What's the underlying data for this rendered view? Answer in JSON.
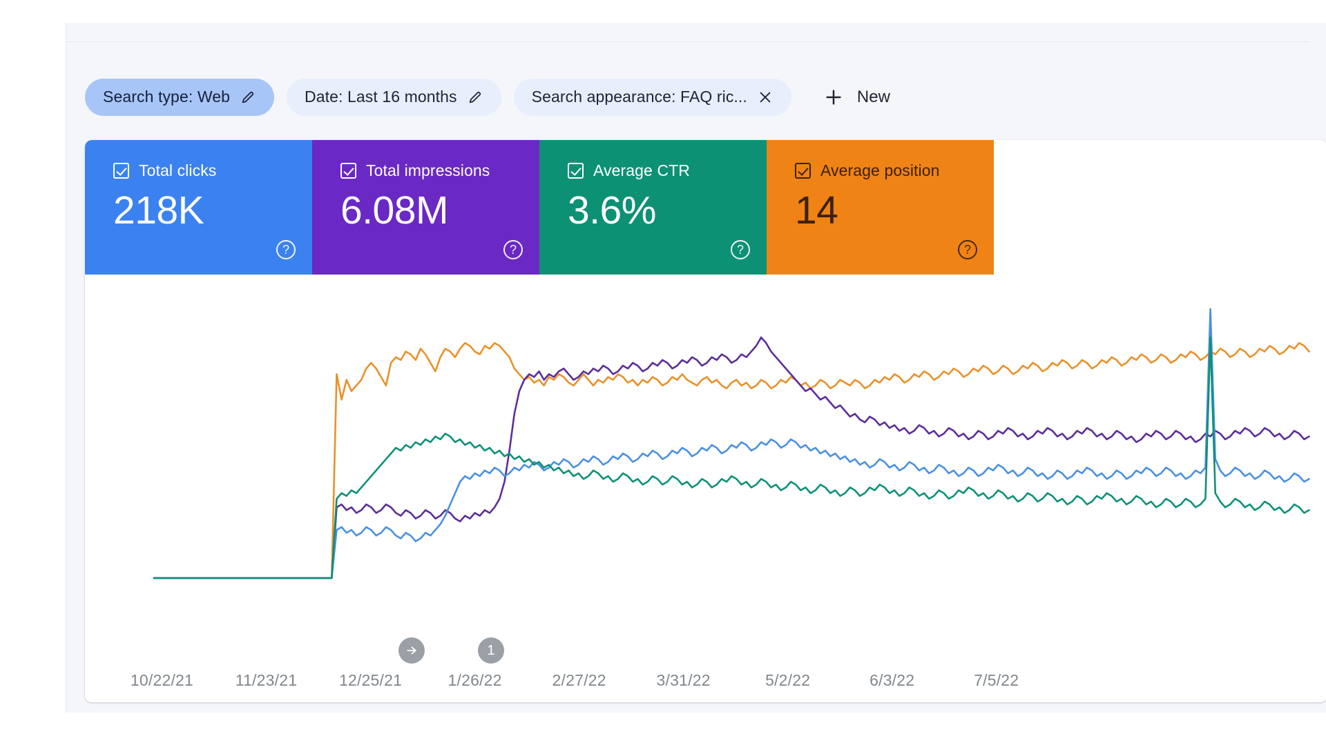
{
  "filters": {
    "chips": [
      {
        "id": "search-type",
        "label": "Search type: Web",
        "icon": "pencil-icon",
        "active": true
      },
      {
        "id": "date",
        "label": "Date: Last 16 months",
        "icon": "pencil-icon",
        "active": false
      },
      {
        "id": "search-appearance",
        "label": "Search appearance: FAQ ric...",
        "icon": "close-icon",
        "active": false
      }
    ],
    "new_button": {
      "label": "New",
      "icon": "plus-icon"
    }
  },
  "metrics": [
    {
      "id": "total-clicks",
      "label": "Total clicks",
      "value": "218K",
      "checked": true,
      "bg": "#3b82f0",
      "fg": "#ffffff",
      "help": "?"
    },
    {
      "id": "total-impressions",
      "label": "Total impressions",
      "value": "6.08M",
      "checked": true,
      "bg": "#6a29c4",
      "fg": "#ffffff",
      "help": "?"
    },
    {
      "id": "average-ctr",
      "label": "Average CTR",
      "value": "3.6%",
      "checked": true,
      "bg": "#0d9175",
      "fg": "#ffffff",
      "help": "?"
    },
    {
      "id": "average-position",
      "label": "Average position",
      "value": "14",
      "checked": true,
      "bg": "#ef8316",
      "fg": "#3d2000",
      "help": "?"
    }
  ],
  "annotations": [
    {
      "id": "annotation-arrow",
      "icon": "arrow-right-icon",
      "label": "",
      "x_pct": 26.3
    },
    {
      "id": "annotation-one",
      "icon": "number-badge",
      "label": "1",
      "x_pct": 32.7
    }
  ],
  "chart_data": {
    "type": "line",
    "title": "",
    "xlabel": "",
    "ylabel": "",
    "grid": false,
    "legend_position": "none",
    "x_tick_labels": [
      "10/22/21",
      "11/23/21",
      "12/25/21",
      "1/26/22",
      "2/27/22",
      "3/31/22",
      "5/2/22",
      "6/3/22",
      "7/5/22"
    ],
    "x_tick_positions_pct": [
      6.2,
      14.6,
      23.0,
      31.4,
      39.8,
      48.2,
      56.6,
      65.0,
      73.4
    ],
    "series": [
      {
        "name": "Average position",
        "color": "#e8912a",
        "values": [
          0,
          0,
          0,
          0,
          0,
          0,
          0,
          0,
          0,
          0,
          0,
          0,
          0,
          0,
          0,
          0,
          0,
          0,
          0,
          0,
          0,
          0,
          0,
          0,
          0,
          0,
          0,
          0,
          0,
          0,
          0,
          0,
          0,
          0,
          0,
          0,
          0,
          72,
          63,
          70,
          66,
          68,
          70,
          74,
          76,
          74,
          71,
          68,
          76,
          78,
          77,
          80,
          79,
          77,
          81,
          79,
          76,
          73,
          78,
          81,
          80,
          78,
          81,
          83,
          82,
          80,
          79,
          82,
          81,
          83,
          82,
          80,
          78,
          74,
          72,
          70,
          71,
          69,
          70,
          68,
          71,
          70,
          72,
          71,
          69,
          68,
          70,
          72,
          70,
          68,
          70,
          69,
          71,
          70,
          72,
          71,
          69,
          70,
          68,
          70,
          69,
          71,
          70,
          68,
          69,
          71,
          70,
          72,
          70,
          69,
          68,
          70,
          71,
          69,
          70,
          68,
          67,
          69,
          70,
          68,
          69,
          67,
          68,
          70,
          69,
          67,
          68,
          70,
          69,
          71,
          70,
          68,
          69,
          67,
          68,
          70,
          69,
          67,
          68,
          70,
          69,
          68,
          70,
          69,
          67,
          68,
          70,
          69,
          71,
          70,
          72,
          71,
          69,
          70,
          72,
          71,
          73,
          72,
          70,
          71,
          73,
          72,
          74,
          73,
          71,
          72,
          74,
          73,
          75,
          74,
          72,
          73,
          75,
          74,
          72,
          73,
          75,
          74,
          76,
          75,
          73,
          74,
          76,
          75,
          77,
          76,
          74,
          75,
          77,
          76,
          74,
          75,
          77,
          76,
          78,
          77,
          75,
          76,
          78,
          77,
          79,
          78,
          76,
          77,
          79,
          78,
          76,
          77,
          79,
          78,
          80,
          79,
          77,
          78,
          80,
          79,
          81,
          80,
          78,
          79,
          81,
          80,
          78,
          79,
          81,
          80,
          82,
          81,
          79,
          80,
          82,
          81,
          83,
          82,
          80
        ]
      },
      {
        "name": "Total impressions",
        "color": "#5b2d9c",
        "values": [
          0,
          0,
          0,
          0,
          0,
          0,
          0,
          0,
          0,
          0,
          0,
          0,
          0,
          0,
          0,
          0,
          0,
          0,
          0,
          0,
          0,
          0,
          0,
          0,
          0,
          0,
          0,
          0,
          0,
          0,
          0,
          0,
          0,
          0,
          0,
          0,
          0,
          25,
          26,
          24,
          25,
          23,
          24,
          26,
          25,
          23,
          24,
          26,
          25,
          23,
          22,
          24,
          23,
          21,
          22,
          24,
          23,
          21,
          22,
          24,
          23,
          21,
          20,
          22,
          21,
          23,
          22,
          24,
          23,
          25,
          28,
          34,
          45,
          58,
          66,
          70,
          72,
          71,
          73,
          70,
          72,
          71,
          73,
          74,
          72,
          70,
          71,
          73,
          72,
          74,
          73,
          75,
          74,
          72,
          73,
          75,
          74,
          76,
          75,
          73,
          74,
          76,
          75,
          77,
          76,
          74,
          75,
          77,
          76,
          78,
          77,
          75,
          76,
          78,
          77,
          79,
          78,
          76,
          77,
          79,
          78,
          80,
          82,
          85,
          83,
          80,
          78,
          76,
          74,
          72,
          70,
          68,
          66,
          67,
          65,
          63,
          64,
          62,
          60,
          61,
          59,
          57,
          58,
          56,
          55,
          57,
          56,
          54,
          55,
          53,
          54,
          52,
          53,
          51,
          52,
          54,
          53,
          51,
          52,
          50,
          51,
          53,
          52,
          50,
          51,
          49,
          50,
          52,
          51,
          49,
          50,
          52,
          51,
          53,
          52,
          50,
          51,
          49,
          50,
          52,
          51,
          53,
          52,
          50,
          51,
          49,
          50,
          52,
          51,
          53,
          52,
          50,
          51,
          49,
          50,
          52,
          51,
          49,
          50,
          48,
          49,
          51,
          50,
          52,
          51,
          49,
          50,
          52,
          51,
          49,
          50,
          48,
          49,
          51,
          50,
          52,
          51,
          49,
          50,
          52,
          51,
          53,
          52,
          50,
          51,
          53,
          52,
          50,
          51,
          49,
          50,
          52,
          51,
          49,
          50
        ]
      },
      {
        "name": "Total clicks",
        "color": "#4a90e2",
        "values": [
          0,
          0,
          0,
          0,
          0,
          0,
          0,
          0,
          0,
          0,
          0,
          0,
          0,
          0,
          0,
          0,
          0,
          0,
          0,
          0,
          0,
          0,
          0,
          0,
          0,
          0,
          0,
          0,
          0,
          0,
          0,
          0,
          0,
          0,
          0,
          0,
          0,
          17,
          18,
          16,
          17,
          15,
          16,
          18,
          17,
          15,
          16,
          18,
          17,
          15,
          14,
          16,
          15,
          13,
          14,
          16,
          15,
          17,
          19,
          22,
          26,
          30,
          34,
          36,
          35,
          37,
          36,
          38,
          37,
          39,
          38,
          36,
          37,
          39,
          38,
          40,
          39,
          41,
          40,
          38,
          39,
          41,
          40,
          42,
          41,
          39,
          40,
          42,
          41,
          43,
          42,
          40,
          41,
          43,
          42,
          44,
          43,
          41,
          42,
          44,
          43,
          45,
          44,
          42,
          43,
          45,
          44,
          46,
          45,
          43,
          44,
          46,
          45,
          47,
          46,
          44,
          45,
          47,
          46,
          48,
          47,
          45,
          46,
          48,
          47,
          49,
          48,
          46,
          47,
          49,
          48,
          46,
          47,
          45,
          46,
          44,
          45,
          43,
          44,
          42,
          43,
          41,
          42,
          40,
          41,
          39,
          40,
          42,
          41,
          39,
          40,
          38,
          39,
          41,
          40,
          38,
          39,
          37,
          38,
          40,
          39,
          37,
          38,
          36,
          37,
          39,
          38,
          36,
          37,
          39,
          38,
          40,
          39,
          37,
          38,
          36,
          37,
          39,
          38,
          36,
          37,
          35,
          36,
          38,
          37,
          35,
          36,
          38,
          37,
          39,
          38,
          36,
          37,
          35,
          36,
          38,
          37,
          35,
          36,
          38,
          37,
          39,
          38,
          36,
          37,
          39,
          38,
          36,
          37,
          35,
          36,
          38,
          37,
          39,
          95,
          42,
          38,
          36,
          37,
          39,
          38,
          36,
          37,
          35,
          36,
          38,
          37,
          35,
          36,
          34,
          35,
          37,
          36,
          34,
          35
        ]
      },
      {
        "name": "Average CTR",
        "color": "#0d9175",
        "values": [
          0,
          0,
          0,
          0,
          0,
          0,
          0,
          0,
          0,
          0,
          0,
          0,
          0,
          0,
          0,
          0,
          0,
          0,
          0,
          0,
          0,
          0,
          0,
          0,
          0,
          0,
          0,
          0,
          0,
          0,
          0,
          0,
          0,
          0,
          0,
          0,
          0,
          28,
          30,
          29,
          31,
          30,
          32,
          34,
          36,
          38,
          40,
          42,
          44,
          46,
          45,
          47,
          46,
          48,
          47,
          49,
          48,
          50,
          49,
          51,
          50,
          48,
          49,
          47,
          48,
          46,
          47,
          45,
          46,
          44,
          45,
          43,
          44,
          42,
          43,
          41,
          42,
          40,
          41,
          39,
          40,
          38,
          39,
          37,
          38,
          36,
          37,
          35,
          36,
          38,
          37,
          35,
          36,
          34,
          35,
          37,
          36,
          34,
          35,
          33,
          34,
          36,
          35,
          33,
          34,
          36,
          35,
          33,
          34,
          32,
          33,
          35,
          34,
          32,
          33,
          35,
          34,
          36,
          35,
          33,
          34,
          32,
          33,
          35,
          34,
          32,
          33,
          31,
          32,
          34,
          33,
          31,
          32,
          30,
          31,
          33,
          32,
          30,
          31,
          29,
          30,
          32,
          31,
          29,
          30,
          32,
          31,
          33,
          32,
          30,
          31,
          29,
          30,
          32,
          31,
          29,
          30,
          28,
          29,
          31,
          30,
          28,
          29,
          31,
          30,
          32,
          31,
          29,
          30,
          28,
          29,
          31,
          30,
          28,
          29,
          27,
          28,
          30,
          29,
          27,
          28,
          30,
          29,
          27,
          28,
          26,
          27,
          29,
          28,
          26,
          27,
          29,
          28,
          30,
          29,
          27,
          28,
          26,
          27,
          29,
          28,
          26,
          27,
          25,
          26,
          28,
          27,
          25,
          26,
          28,
          27,
          25,
          26,
          28,
          85,
          30,
          27,
          25,
          26,
          28,
          27,
          25,
          26,
          24,
          25,
          27,
          26,
          24,
          25,
          23,
          24,
          26,
          25,
          23,
          24
        ]
      }
    ]
  }
}
